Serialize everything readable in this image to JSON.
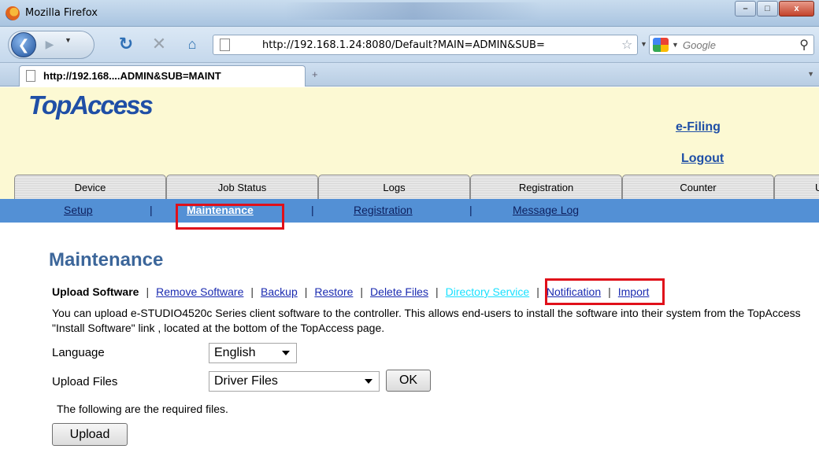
{
  "browser": {
    "window_title": "Mozilla Firefox",
    "url": "http://192.168.1.24:8080/Default?MAIN=ADMIN&SUB=",
    "search_placeholder": "Google",
    "tab_title": "http://192.168....ADMIN&SUB=MAINT",
    "new_tab_symbol": "+",
    "controls": {
      "minimize": "–",
      "maximize": "□",
      "close": "x"
    }
  },
  "header": {
    "logo": "TopAccess",
    "efiling_link": "e-Filing",
    "logout_link": "Logout"
  },
  "top_tabs": [
    "Device",
    "Job Status",
    "Logs",
    "Registration",
    "Counter",
    "Use"
  ],
  "sub_nav": {
    "items": [
      "Setup",
      "Maintenance",
      "Registration",
      "Message Log"
    ],
    "active": "Maintenance",
    "separator": "|"
  },
  "content": {
    "heading": "Maintenance",
    "links": {
      "current": "Upload Software",
      "items": [
        "Remove Software",
        "Backup",
        "Restore",
        "Delete Files",
        "Directory Service",
        "Notification",
        "Import"
      ],
      "highlighted": "Directory Service",
      "separator": "|"
    },
    "description": "You can upload e-STUDIO4520c Series client software to the controller. This allows end-users to install the software into their system from the TopAccess \"Install Software\" link , located at the bottom of the TopAccess page.",
    "language": {
      "label": "Language",
      "value": "English"
    },
    "upload_files": {
      "label": "Upload Files",
      "value": "Driver Files",
      "ok_button": "OK"
    },
    "required_note": "The following are the required files.",
    "upload_button": "Upload"
  },
  "colors": {
    "header_bg": "#fcf9d3",
    "subnav_bg": "#5390d5",
    "link": "#1a2ab0",
    "heading": "#3c669a",
    "highlight_box": "#e0101a"
  }
}
